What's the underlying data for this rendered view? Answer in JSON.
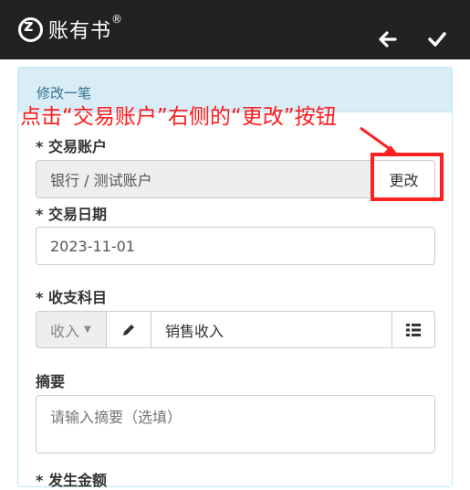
{
  "app": {
    "name": "账有书",
    "trademark": "®"
  },
  "toolbar": {
    "back_icon": "arrow-left-icon",
    "confirm_icon": "check-icon"
  },
  "panel": {
    "title": "修改一笔"
  },
  "annotation": {
    "text": "点击“交易账户”右侧的“更改”按钮",
    "color": "#ff1a1a"
  },
  "form": {
    "account": {
      "label": "* 交易账户",
      "value": "银行 / 测试账户",
      "change_button": "更改"
    },
    "date": {
      "label": "* 交易日期",
      "value": "2023-11-01"
    },
    "category": {
      "label": "* 收支科目",
      "type_value": "收入",
      "edit_icon": "pencil-icon",
      "value": "销售收入",
      "list_icon": "list-icon"
    },
    "memo": {
      "label": "摘要",
      "placeholder": "请输入摘要（选填）"
    },
    "amount": {
      "label": "* 发生金额"
    }
  },
  "colors": {
    "topbar": "#222222",
    "panel_header": "#d9edf7",
    "panel_title": "#31708f",
    "highlight": "#ff2020"
  }
}
